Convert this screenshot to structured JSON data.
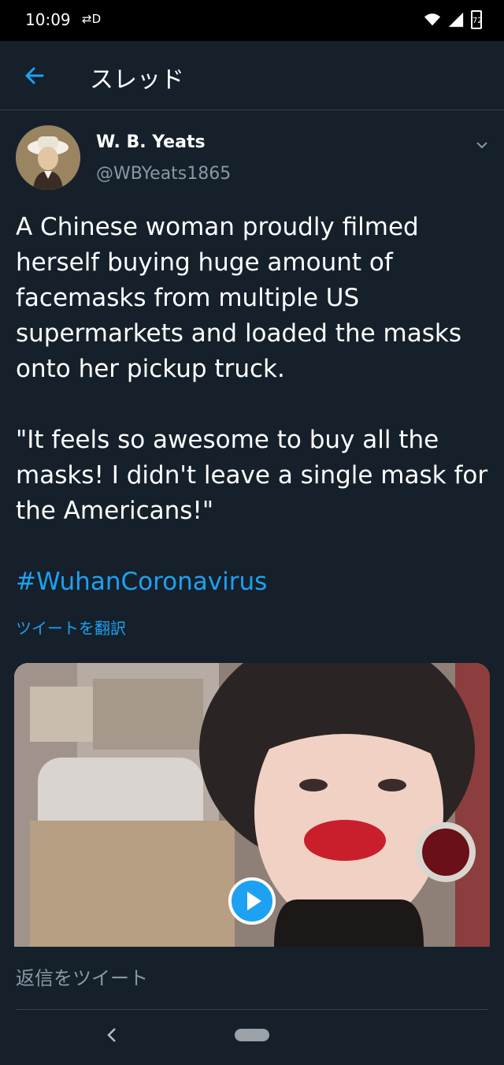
{
  "status_bar": {
    "time": "10:09",
    "sync_glyph": "⇄D",
    "battery": "72"
  },
  "header": {
    "title": "スレッド",
    "back_icon": "back-arrow-icon"
  },
  "tweet": {
    "name": "W. B. Yeats",
    "handle": "@WBYeats1865",
    "text": "A Chinese woman proudly filmed herself buying huge amount of facemasks from multiple US supermarkets and loaded the masks onto her pickup truck.\n\n\"It feels so awesome to buy all the masks! I didn't leave a single mask for the Americans!\"",
    "hashtag": "#WuhanCoronavirus",
    "translate_label": "ツイートを翻訳"
  },
  "reply": {
    "placeholder": "返信をツイート"
  },
  "colors": {
    "background": "#15202b",
    "accent": "#1da1f2",
    "muted": "#8899a6"
  }
}
